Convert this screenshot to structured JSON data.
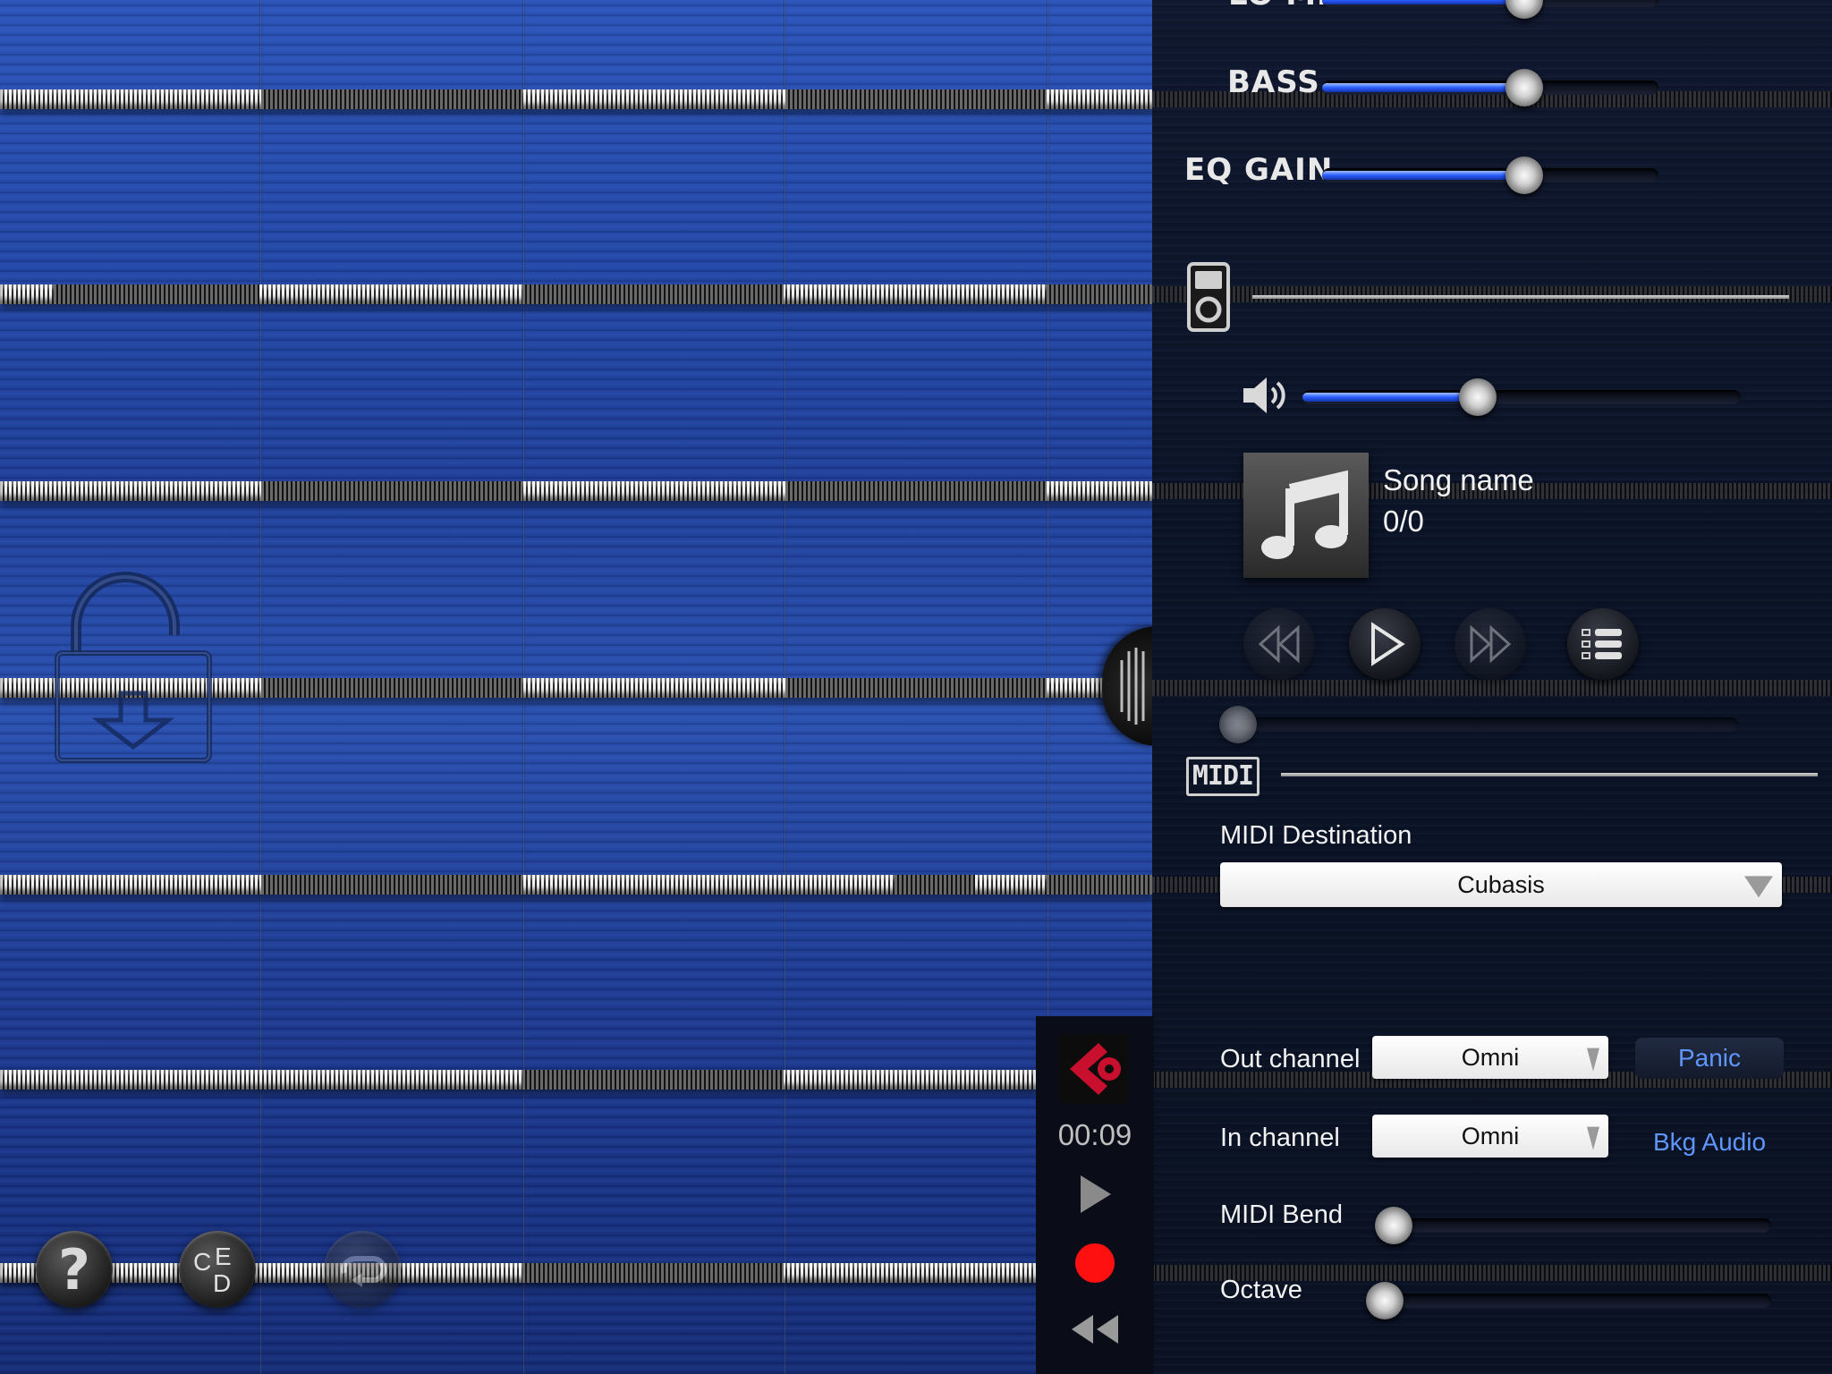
{
  "board": {
    "lock_icon": "unlock-download-icon",
    "help_label": "?",
    "chord_letters": {
      "c": "C",
      "e": "E",
      "d": "D"
    },
    "loop_icon": "loop-icon"
  },
  "eq": {
    "lo_mid_label": "LO MID",
    "bass_label": "BASS",
    "eq_gain_label": "EQ GAIN",
    "lo_mid_value": 0.6,
    "bass_value": 0.6,
    "eq_gain_value": 0.6
  },
  "player": {
    "player_icon": "media-player-icon",
    "volume_icon": "speaker-icon",
    "volume_value": 0.4,
    "song_name": "Song name",
    "song_count": "0/0",
    "artwork_icon": "music-note-icon",
    "controls": [
      "rewind-icon",
      "play-icon",
      "fast-forward-icon",
      "playlist-icon"
    ],
    "progress_value": 0.0
  },
  "midi": {
    "midi_logo": "MIDI",
    "destination_label": "MIDI Destination",
    "destination_value": "Cubasis",
    "out_channel_label": "Out channel",
    "out_channel_value": "Omni",
    "in_channel_label": "In channel",
    "in_channel_value": "Omni",
    "panic_label": "Panic",
    "bkg_audio_label": "Bkg Audio",
    "midi_bend_label": "MIDI Bend",
    "midi_bend_value": 0.0,
    "octave_label": "Octave",
    "octave_value": 0.0
  },
  "recorder": {
    "time": "00:09",
    "app_icon": "cubasis-icon"
  },
  "colors": {
    "accent_blue": "#5f96ff",
    "record_red": "#ff1010",
    "cubasis_red": "#c8102e"
  }
}
